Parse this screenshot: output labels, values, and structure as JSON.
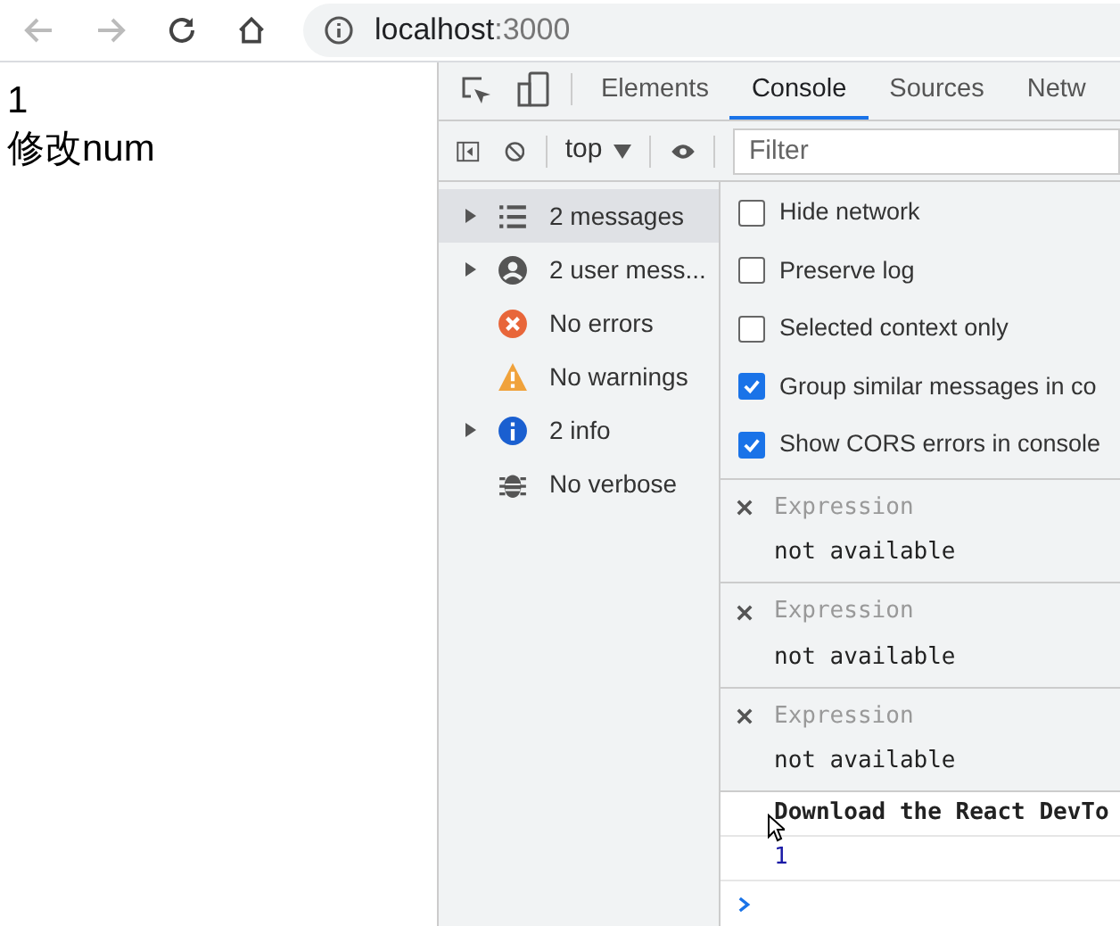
{
  "browser": {
    "address": "localhost",
    "port": ":3000"
  },
  "page": {
    "lines": [
      "1",
      "修改num"
    ]
  },
  "devtools": {
    "tabs": [
      {
        "label": "Elements",
        "selected": false
      },
      {
        "label": "Console",
        "selected": true
      },
      {
        "label": "Sources",
        "selected": false
      },
      {
        "label": "Netw",
        "selected": false
      }
    ],
    "toolbar": {
      "context": "top",
      "filter_placeholder": "Filter"
    },
    "sidebar": [
      {
        "label": "2 messages",
        "kind": "list",
        "expandable": true,
        "selected": true
      },
      {
        "label": "2 user mess...",
        "kind": "user",
        "expandable": true,
        "selected": false
      },
      {
        "label": "No errors",
        "kind": "error",
        "expandable": false,
        "selected": false
      },
      {
        "label": "No warnings",
        "kind": "warning",
        "expandable": false,
        "selected": false
      },
      {
        "label": "2 info",
        "kind": "info",
        "expandable": true,
        "selected": false
      },
      {
        "label": "No verbose",
        "kind": "verbose",
        "expandable": false,
        "selected": false
      }
    ],
    "settings": [
      {
        "label": "Hide network",
        "checked": false
      },
      {
        "label": "Preserve log",
        "checked": false
      },
      {
        "label": "Selected context only",
        "checked": false
      },
      {
        "label": "Group similar messages in co",
        "checked": true
      },
      {
        "label": "Show CORS errors in console",
        "checked": true
      }
    ],
    "expressions": [
      {
        "name": "Expression",
        "value": "not available"
      },
      {
        "name": "Expression",
        "value": "not available"
      },
      {
        "name": "Expression",
        "value": "not available"
      }
    ],
    "messages": [
      {
        "text": "Download the React DevTo",
        "kind": "bold"
      },
      {
        "text": "1",
        "kind": "number"
      }
    ]
  }
}
